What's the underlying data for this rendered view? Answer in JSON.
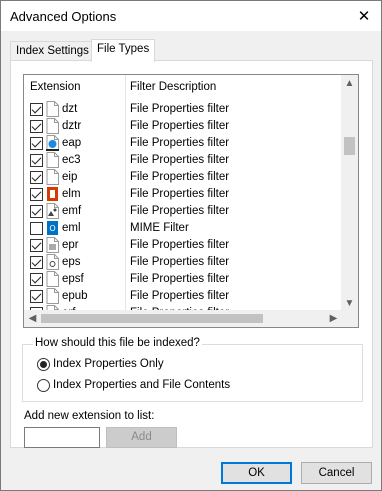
{
  "window": {
    "title": "Advanced Options",
    "close_glyph": "✕"
  },
  "tabs": [
    {
      "label": "Index Settings",
      "active": false
    },
    {
      "label": "File Types",
      "active": true
    }
  ],
  "list": {
    "columns": [
      "Extension",
      "Filter Description"
    ],
    "rows": [
      {
        "ext": "dzt",
        "desc": "File Properties filter",
        "checked": true,
        "icon": "blank-file-icon"
      },
      {
        "ext": "dztr",
        "desc": "File Properties filter",
        "checked": true,
        "icon": "blank-file-icon"
      },
      {
        "ext": "eap",
        "desc": "File Properties filter",
        "checked": true,
        "icon": "app-file-icon"
      },
      {
        "ext": "ec3",
        "desc": "File Properties filter",
        "checked": true,
        "icon": "blank-file-icon"
      },
      {
        "ext": "eip",
        "desc": "File Properties filter",
        "checked": true,
        "icon": "blank-file-icon"
      },
      {
        "ext": "elm",
        "desc": "File Properties filter",
        "checked": true,
        "icon": "office-file-icon"
      },
      {
        "ext": "emf",
        "desc": "File Properties filter",
        "checked": true,
        "icon": "image-file-icon"
      },
      {
        "ext": "eml",
        "desc": "MIME Filter",
        "checked": false,
        "icon": "outlook-file-icon"
      },
      {
        "ext": "epr",
        "desc": "File Properties filter",
        "checked": true,
        "icon": "settings-file-icon"
      },
      {
        "ext": "eps",
        "desc": "File Properties filter",
        "checked": true,
        "icon": "ps-file-icon"
      },
      {
        "ext": "epsf",
        "desc": "File Properties filter",
        "checked": true,
        "icon": "blank-file-icon"
      },
      {
        "ext": "epub",
        "desc": "File Properties filter",
        "checked": true,
        "icon": "blank-file-icon"
      },
      {
        "ext": "erf",
        "desc": "File Properties filter",
        "checked": true,
        "icon": "blank-file-icon"
      }
    ]
  },
  "index_group": {
    "label": "How should this file be indexed?",
    "options": [
      {
        "label": "Index Properties Only",
        "selected": true
      },
      {
        "label": "Index Properties and File Contents",
        "selected": false
      }
    ]
  },
  "add_extension": {
    "label": "Add new extension to list:",
    "value": "",
    "button_label": "Add"
  },
  "buttons": {
    "ok": "OK",
    "cancel": "Cancel"
  },
  "colors": {
    "accent": "#0078d7",
    "outlook": "#0072c6",
    "office": "#d83b01"
  }
}
